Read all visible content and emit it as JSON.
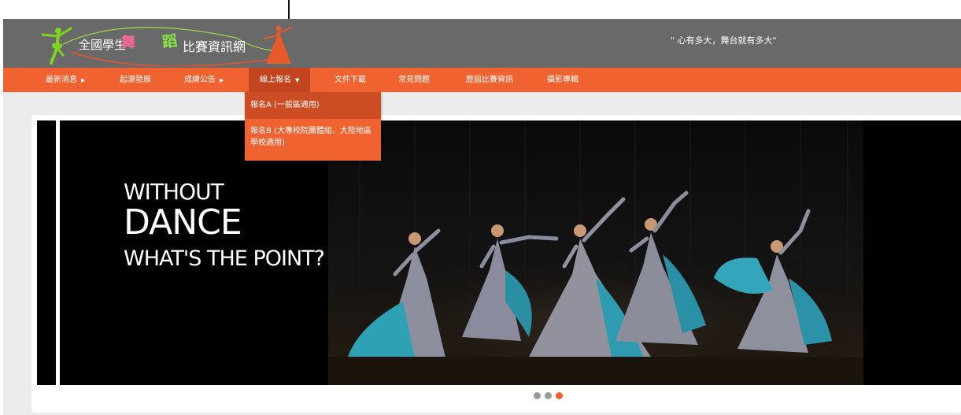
{
  "header": {
    "logo_text_parts": [
      "全國學生",
      "舞",
      "蹈",
      "比賽資訊網"
    ],
    "slogan": "\" 心有多大，舞台就有多大\""
  },
  "nav": {
    "items": [
      {
        "label": "最新消息",
        "has_arrow": true
      },
      {
        "label": "起源發展",
        "has_arrow": false
      },
      {
        "label": "成績公告",
        "has_arrow": true
      },
      {
        "label": "線上報名",
        "has_arrow": true,
        "expanded": true
      },
      {
        "label": "文件下載",
        "has_arrow": false
      },
      {
        "label": "常見問題",
        "has_arrow": false
      },
      {
        "label": "歷屆比賽資訊",
        "has_arrow": false
      },
      {
        "label": "攝影專輯",
        "has_arrow": false
      }
    ],
    "right_arrow_glyph": "▶",
    "down_arrow_glyph": "▼"
  },
  "dropdown": {
    "items": [
      {
        "label": "報名A (一般區適用)",
        "highlighted": true
      },
      {
        "label": "報名B (大專校院團體組、大陸地區學校適用)",
        "highlighted": false
      }
    ]
  },
  "slide": {
    "headline_line1": "WITHOUT",
    "headline_line2": "DANCE",
    "headline_line3": "WHAT'S THE POINT?"
  },
  "pagination": {
    "count": 3,
    "active_index": 2
  },
  "colors": {
    "header_bg": "#696969",
    "nav_bg": "#f0622f",
    "nav_active_bg": "#c3451f",
    "dropdown_highlight": "#cc4d24",
    "logo_green": "#8ae640",
    "logo_pink": "#ff6a9a",
    "dot_active": "#f0622f",
    "dot_inactive": "#9a9a9a"
  }
}
